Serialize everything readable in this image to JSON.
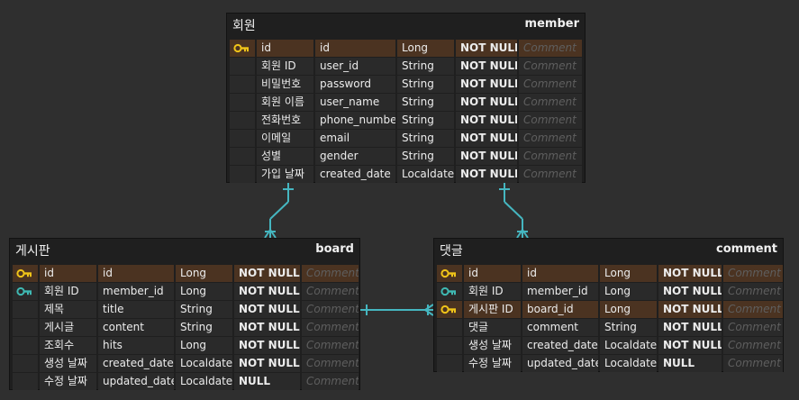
{
  "colors": {
    "primary_key": "#f0c419",
    "foreign_key": "#3fb9b3",
    "relation_line": "#45b6c0"
  },
  "tables": {
    "member": {
      "logical_name": "회원",
      "physical_name": "member",
      "columns": [
        {
          "key": "primary",
          "logical": "id",
          "physical": "id",
          "type": "Long",
          "nullable": "NOT NULL",
          "comment": "Comment"
        },
        {
          "key": "",
          "logical": "회원 ID",
          "physical": "user_id",
          "type": "String",
          "nullable": "NOT NULL",
          "comment": "Comment"
        },
        {
          "key": "",
          "logical": "비밀번호",
          "physical": "password",
          "type": "String",
          "nullable": "NOT NULL",
          "comment": "Comment"
        },
        {
          "key": "",
          "logical": "회원 이름",
          "physical": "user_name",
          "type": "String",
          "nullable": "NOT NULL",
          "comment": "Comment"
        },
        {
          "key": "",
          "logical": "전화번호",
          "physical": "phone_number",
          "type": "String",
          "nullable": "NOT NULL",
          "comment": "Comment"
        },
        {
          "key": "",
          "logical": "이메일",
          "physical": "email",
          "type": "String",
          "nullable": "NOT NULL",
          "comment": "Comment"
        },
        {
          "key": "",
          "logical": "성별",
          "physical": "gender",
          "type": "String",
          "nullable": "NOT NULL",
          "comment": "Comment"
        },
        {
          "key": "",
          "logical": "가입 날짜",
          "physical": "created_date",
          "type": "Localdate",
          "nullable": "NOT NULL",
          "comment": "Comment"
        }
      ]
    },
    "board": {
      "logical_name": "게시판",
      "physical_name": "board",
      "columns": [
        {
          "key": "primary",
          "logical": "id",
          "physical": "id",
          "type": "Long",
          "nullable": "NOT NULL",
          "comment": "Comment"
        },
        {
          "key": "foreign",
          "logical": "회원 ID",
          "physical": "member_id",
          "type": "Long",
          "nullable": "NOT NULL",
          "comment": "Comment"
        },
        {
          "key": "",
          "logical": "제목",
          "physical": "title",
          "type": "String",
          "nullable": "NOT NULL",
          "comment": "Comment"
        },
        {
          "key": "",
          "logical": "게시글",
          "physical": "content",
          "type": "String",
          "nullable": "NOT NULL",
          "comment": "Comment"
        },
        {
          "key": "",
          "logical": "조회수",
          "physical": "hits",
          "type": "Long",
          "nullable": "NOT NULL",
          "comment": "Comment"
        },
        {
          "key": "",
          "logical": "생성 날짜",
          "physical": "created_date",
          "type": "Localdate",
          "nullable": "NOT NULL",
          "comment": "Comment"
        },
        {
          "key": "",
          "logical": "수정 날짜",
          "physical": "updated_date",
          "type": "Localdate",
          "nullable": "NULL",
          "comment": "Comment"
        }
      ]
    },
    "comment": {
      "logical_name": "댓글",
      "physical_name": "comment",
      "columns": [
        {
          "key": "primary",
          "logical": "id",
          "physical": "id",
          "type": "Long",
          "nullable": "NOT NULL",
          "comment": "Comment"
        },
        {
          "key": "foreign",
          "logical": "회원 ID",
          "physical": "member_id",
          "type": "Long",
          "nullable": "NOT NULL",
          "comment": "Comment"
        },
        {
          "key": "primary-foreign",
          "logical": "게시판 ID",
          "physical": "board_id",
          "type": "Long",
          "nullable": "NOT NULL",
          "comment": "Comment"
        },
        {
          "key": "",
          "logical": "댓글",
          "physical": "comment",
          "type": "String",
          "nullable": "NOT NULL",
          "comment": "Comment"
        },
        {
          "key": "",
          "logical": "생성 날짜",
          "physical": "created_date",
          "type": "Localdate",
          "nullable": "NOT NULL",
          "comment": "Comment"
        },
        {
          "key": "",
          "logical": "수정 날짜",
          "physical": "updated_date",
          "type": "Localdate",
          "nullable": "NULL",
          "comment": "Comment"
        }
      ]
    }
  },
  "relationships": [
    {
      "from": "member",
      "to": "board",
      "cardinality": "one-to-many"
    },
    {
      "from": "member",
      "to": "comment",
      "cardinality": "one-to-many"
    },
    {
      "from": "board",
      "to": "comment",
      "cardinality": "one-to-many"
    }
  ]
}
